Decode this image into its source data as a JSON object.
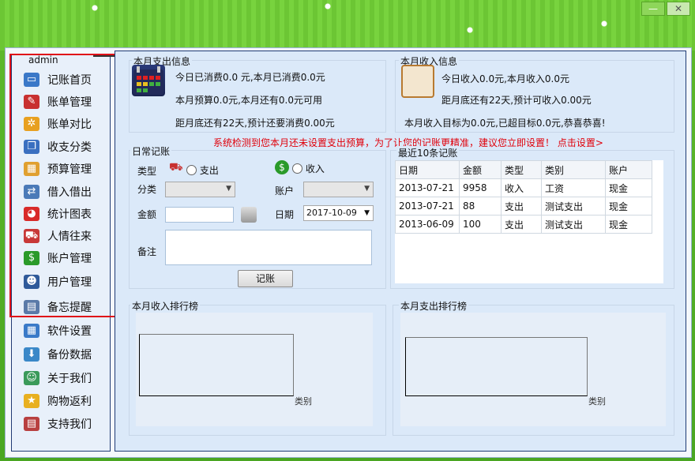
{
  "window": {
    "min_label": "—",
    "close_label": "✕"
  },
  "user": {
    "name": "admin"
  },
  "sidebar": {
    "items": [
      {
        "label": "记账首页",
        "icon": "monitor-icon",
        "color": "#3a78c8",
        "glyph": "▭"
      },
      {
        "label": "账单管理",
        "icon": "pen-icon",
        "color": "#c83030",
        "glyph": "✎"
      },
      {
        "label": "账单对比",
        "icon": "gear-icon",
        "color": "#e8a020",
        "glyph": "✲"
      },
      {
        "label": "收支分类",
        "icon": "windows-icon",
        "color": "#3a6fc0",
        "glyph": "❐"
      },
      {
        "label": "预算管理",
        "icon": "calculator-icon",
        "color": "#e0a030",
        "glyph": "▦"
      },
      {
        "label": "借入借出",
        "icon": "exchange-icon",
        "color": "#4a7ab8",
        "glyph": "⇄"
      },
      {
        "label": "统计图表",
        "icon": "pie-chart-icon",
        "color": "#d82a2a",
        "glyph": "◕"
      },
      {
        "label": "人情往来",
        "icon": "cart-icon",
        "color": "#c83838",
        "glyph": "⛟"
      },
      {
        "label": "账户管理",
        "icon": "dollar-icon",
        "color": "#2a9a2a",
        "glyph": "$"
      },
      {
        "label": "用户管理",
        "icon": "user-icon",
        "color": "#2f5a9a",
        "glyph": "☻"
      },
      {
        "label": "备忘提醒",
        "icon": "memo-icon",
        "color": "#5a7aa8",
        "glyph": "▤"
      },
      {
        "label": "软件设置",
        "icon": "settings-icon",
        "color": "#3a7ac8",
        "glyph": "▦"
      },
      {
        "label": "备份数据",
        "icon": "backup-icon",
        "color": "#3a88c8",
        "glyph": "⬇"
      },
      {
        "label": "关于我们",
        "icon": "contact-card-icon",
        "color": "#3a9a5a",
        "glyph": "☺"
      },
      {
        "label": "购物返利",
        "icon": "star-icon",
        "color": "#e8b020",
        "glyph": "★"
      },
      {
        "label": "支持我们",
        "icon": "window-icon",
        "color": "#b84040",
        "glyph": "▤"
      }
    ]
  },
  "expense_info": {
    "title": "本月支出信息",
    "line1": "今日已消费0.0 元,本月已消费0.0元",
    "line2": "本月预算0.0元,本月还有0.0元可用",
    "line3": "距月底还有22天,预计还要消费0.00元"
  },
  "income_info": {
    "title": "本月收入信息",
    "line1": "今日收入0.0元,本月收入0.0元",
    "line2": "距月底还有22天,预计可收入0.00元",
    "line3": "本月收入目标为0.0元,已超目标0.0元,恭喜恭喜!"
  },
  "warning": "系统检测到您本月还未设置支出预算，为了让您的记账更精准，建议您立即设置！ 点击设置>",
  "daily": {
    "title": "日常记账",
    "type_label": "类型",
    "expense_option": "支出",
    "income_option": "收入",
    "category_label": "分类",
    "account_label": "账户",
    "amount_label": "金额",
    "date_label": "日期",
    "date_value": "2017-10-09",
    "note_label": "备注",
    "submit_label": "记账"
  },
  "recent": {
    "title": "最近10条记账",
    "columns": [
      "日期",
      "金额",
      "类型",
      "类别",
      "账户"
    ],
    "rows": [
      [
        "2013-07-21",
        "9958",
        "收入",
        "工资",
        "现金"
      ],
      [
        "2013-07-21",
        "88",
        "支出",
        "测试支出",
        "现金"
      ],
      [
        "2013-06-09",
        "100",
        "支出",
        "测试支出",
        "现金"
      ]
    ]
  },
  "income_rank": {
    "title": "本月收入排行榜",
    "axis_label": "类别"
  },
  "expense_rank": {
    "title": "本月支出排行榜",
    "axis_label": "类别"
  }
}
